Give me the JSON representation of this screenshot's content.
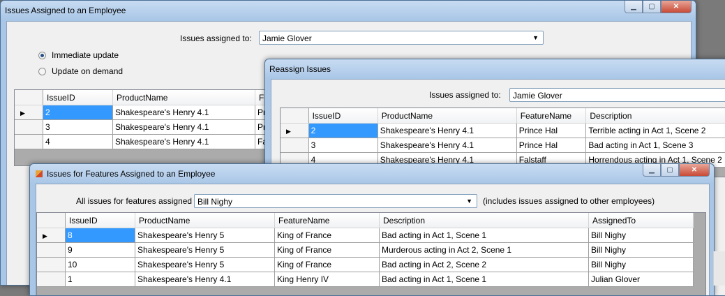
{
  "win1": {
    "title": "Issues Assigned to an Employee",
    "assigned_label": "Issues assigned to:",
    "employee": "Jamie Glover",
    "radio_immediate": "Immediate update",
    "radio_on_demand": "Update on demand",
    "columns": [
      "IssueID",
      "ProductName",
      "Feature"
    ],
    "rows": [
      [
        "2",
        "Shakespeare's Henry 4.1",
        "Prin"
      ],
      [
        "3",
        "Shakespeare's Henry 4.1",
        "Prin"
      ],
      [
        "4",
        "Shakespeare's Henry 4.1",
        "Falst"
      ]
    ]
  },
  "win2": {
    "title": "Reassign Issues",
    "assigned_label": "Issues assigned to:",
    "employee": "Jamie Glover",
    "columns": [
      "IssueID",
      "ProductName",
      "FeatureName",
      "Description"
    ],
    "rows": [
      [
        "2",
        "Shakespeare's Henry 4.1",
        "Prince Hal",
        "Terrible acting in Act 1, Scene 2"
      ],
      [
        "3",
        "Shakespeare's Henry 4.1",
        "Prince Hal",
        "Bad acting in Act 1, Scene 3"
      ],
      [
        "4",
        "Shakespeare's Henry 4.1",
        "Falstaff",
        "Horrendous acting in Act 1, Scene 2"
      ]
    ]
  },
  "win3": {
    "title": "Issues for Features Assigned to an Employee",
    "assigned_label": "All issues for features assigned to:",
    "employee": "Bill Nighy",
    "note": "(includes issues assigned to other employees)",
    "columns": [
      "IssueID",
      "ProductName",
      "FeatureName",
      "Description",
      "AssignedTo"
    ],
    "rows": [
      [
        "8",
        "Shakespeare's Henry 5",
        "King of France",
        "Bad acting in Act 1, Scene 1",
        "Bill Nighy"
      ],
      [
        "9",
        "Shakespeare's Henry 5",
        "King of France",
        "Murderous acting in Act 2, Scene 1",
        "Bill Nighy"
      ],
      [
        "10",
        "Shakespeare's Henry 5",
        "King of France",
        "Bad acting in Act 2, Scene 2",
        "Bill Nighy"
      ],
      [
        "1",
        "Shakespeare's Henry 4.1",
        "King Henry IV",
        "Bad acting in Act 1, Scene 1",
        "Julian Glover"
      ]
    ]
  }
}
